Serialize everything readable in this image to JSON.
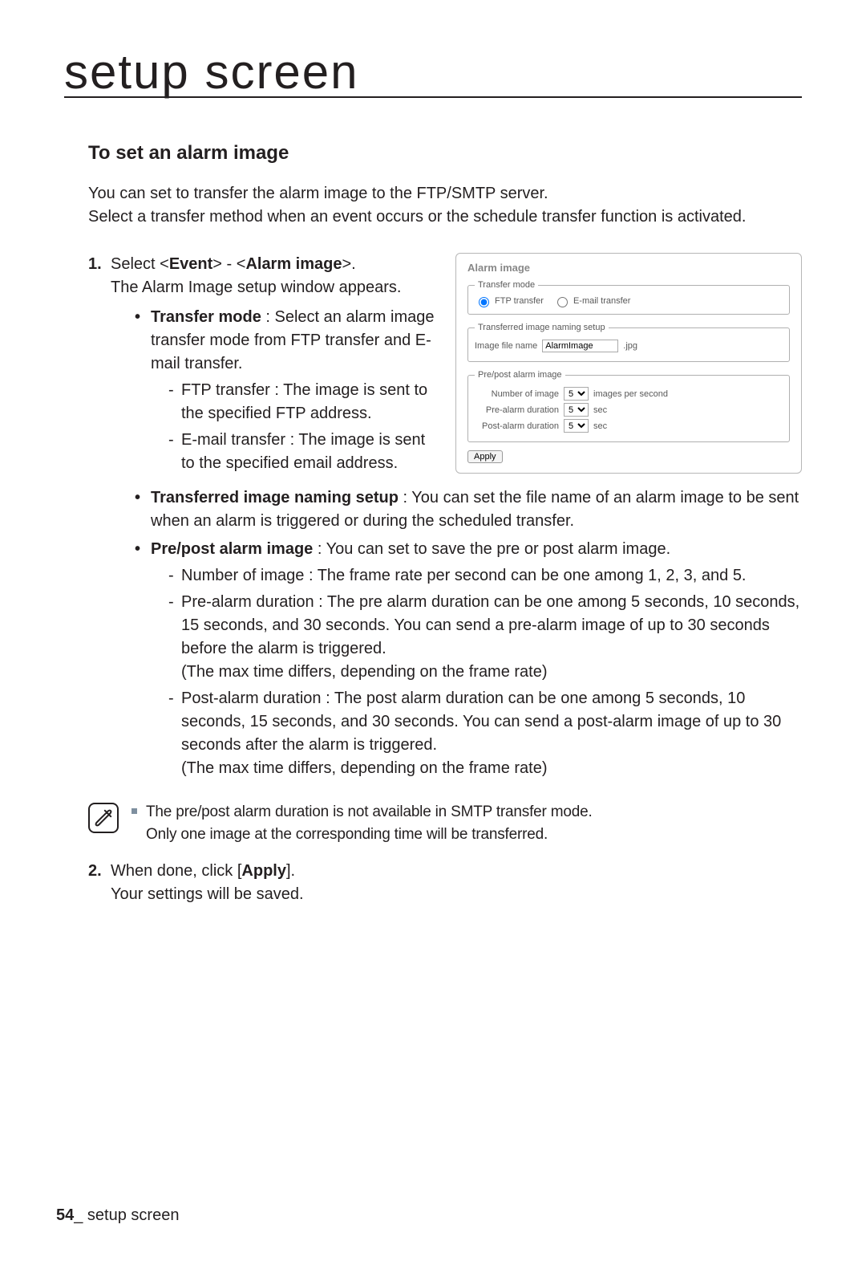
{
  "chapter": "setup screen",
  "section_title": "To set an alarm image",
  "intro_1": "You can set to transfer the alarm image to the FTP/SMTP server.",
  "intro_2": "Select a transfer method when an event occurs or the schedule transfer function is activated.",
  "step1": {
    "pre": "Select <",
    "b1": "Event",
    "mid": "> - <",
    "b2": "Alarm image",
    "post": ">.",
    "line2": "The Alarm Image setup window appears."
  },
  "transfer_mode": {
    "label": "Transfer mode",
    "desc": " : Select an alarm image transfer mode from FTP transfer and E-mail transfer.",
    "ftp": "FTP transfer : The image is sent to the specified FTP address.",
    "email": "E-mail transfer : The image is sent to the specified email address."
  },
  "naming": {
    "label": "Transferred image naming setup",
    "desc": " : You can set the file name of an alarm image to be sent when an alarm is triggered or during the scheduled transfer."
  },
  "prepost": {
    "label": "Pre/post alarm image",
    "desc": " : You can set to save the pre or post alarm image.",
    "num": "Number of image : The frame rate per second can be one among 1, 2, 3, and 5.",
    "pre1": "Pre-alarm duration : The pre alarm duration can be one among 5 seconds, 10 seconds, 15 seconds, and 30 seconds. You can send a pre-alarm image of up to 30 seconds before the alarm is triggered.",
    "pre2": "(The max time differs, depending on the frame rate)",
    "post1": "Post-alarm duration : The post alarm duration can be one among 5 seconds, 10 seconds, 15 seconds, and 30 seconds. You can send a post-alarm image of up to 30 seconds after the alarm is triggered.",
    "post2": "(The max time differs, depending on the frame rate)"
  },
  "note": {
    "line1": "The pre/post alarm duration is not available in SMTP transfer mode.",
    "line2": "Only one image at the corresponding time will be transferred."
  },
  "step2": {
    "pre": "When done, click [",
    "btn": "Apply",
    "post": "].",
    "line2": "Your settings will be saved."
  },
  "panel": {
    "title": "Alarm image",
    "transfer_mode_legend": "Transfer mode",
    "ftp_label": "FTP transfer",
    "email_label": "E-mail transfer",
    "naming_legend": "Transferred image naming setup",
    "file_label": "Image file name",
    "file_value": "AlarmImage",
    "file_ext": ".jpg",
    "prepost_legend": "Pre/post alarm image",
    "num_label": "Number of image",
    "num_val": "5",
    "num_suffix": "images per second",
    "pre_label": "Pre-alarm duration",
    "pre_val": "5",
    "sec": "sec",
    "post_label": "Post-alarm duration",
    "post_val": "5",
    "apply": "Apply"
  },
  "footer": {
    "page": "54",
    "sep": "_",
    "label": " setup screen"
  }
}
